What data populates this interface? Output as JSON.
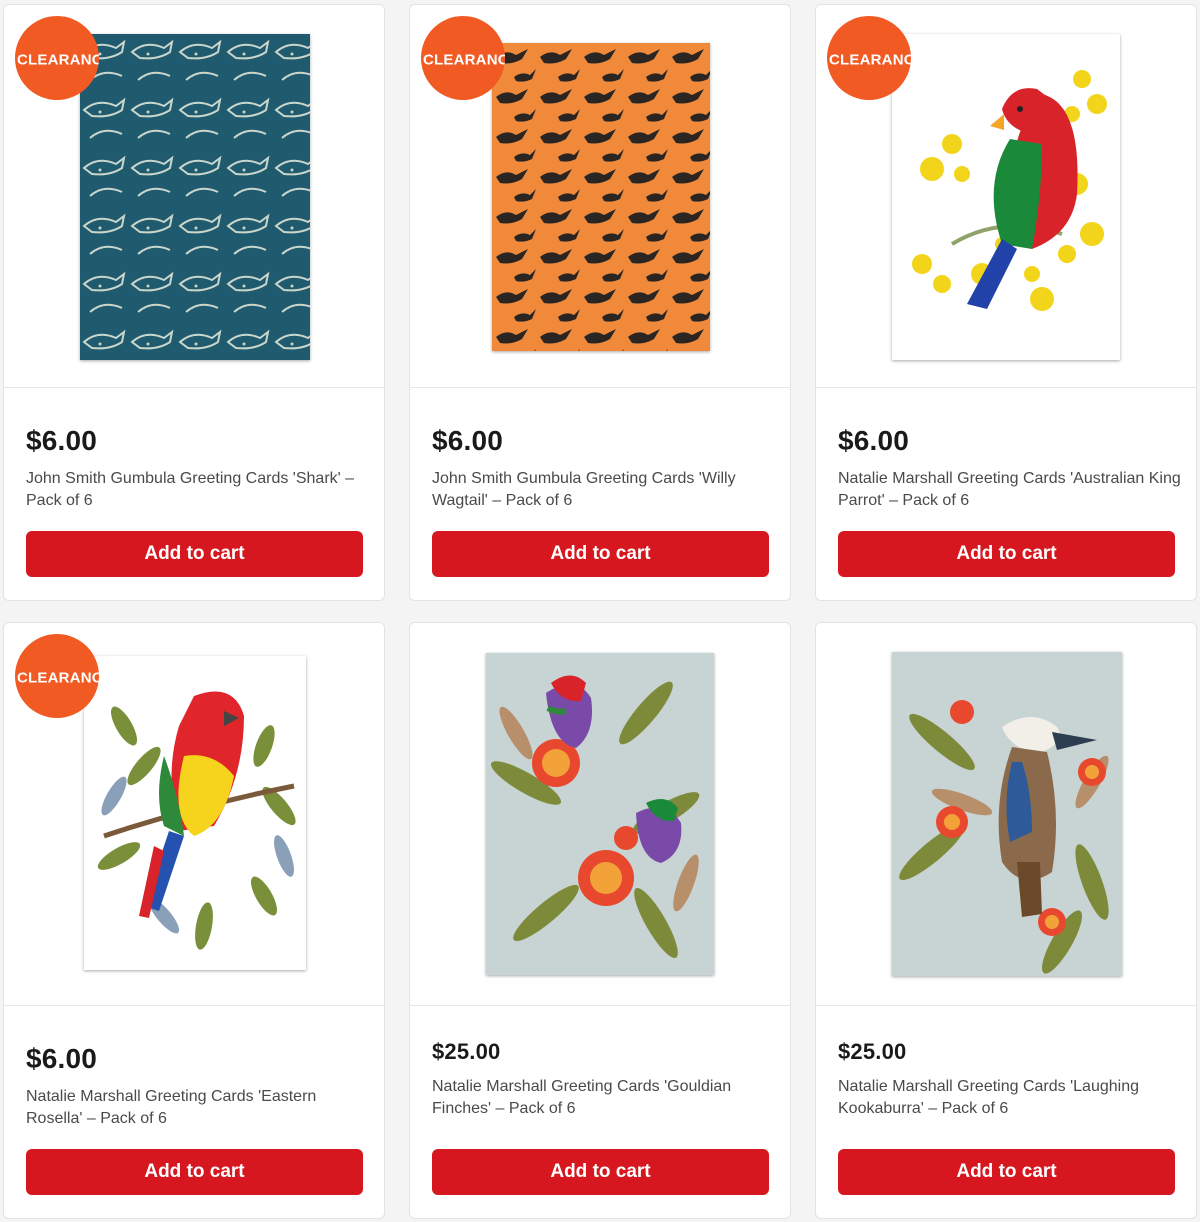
{
  "colors": {
    "accent": "#d7171f",
    "badge": "#f15a22"
  },
  "products": [
    {
      "badge": "CLEARANCE",
      "price": "$6.00",
      "title": "John Smith Gumbula Greeting Cards 'Shark' – Pack of 6",
      "button": "Add to cart"
    },
    {
      "badge": "CLEARANCE",
      "price": "$6.00",
      "title": "John Smith Gumbula Greeting Cards 'Willy Wagtail' – Pack of 6",
      "button": "Add to cart"
    },
    {
      "badge": "CLEARANCE",
      "price": "$6.00",
      "title": "Natalie Marshall Greeting Cards 'Australian King Parrot' – Pack of 6",
      "button": "Add to cart"
    },
    {
      "badge": "CLEARANCE",
      "price": "$6.00",
      "title": "Natalie Marshall Greeting Cards 'Eastern Rosella' – Pack of 6",
      "button": "Add to cart"
    },
    {
      "price": "$25.00",
      "title": "Natalie Marshall Greeting Cards 'Gouldian Finches' – Pack of 6",
      "button": "Add to cart"
    },
    {
      "price": "$25.00",
      "title": "Natalie Marshall Greeting Cards 'Laughing Kookaburra' – Pack of 6",
      "button": "Add to cart"
    }
  ]
}
